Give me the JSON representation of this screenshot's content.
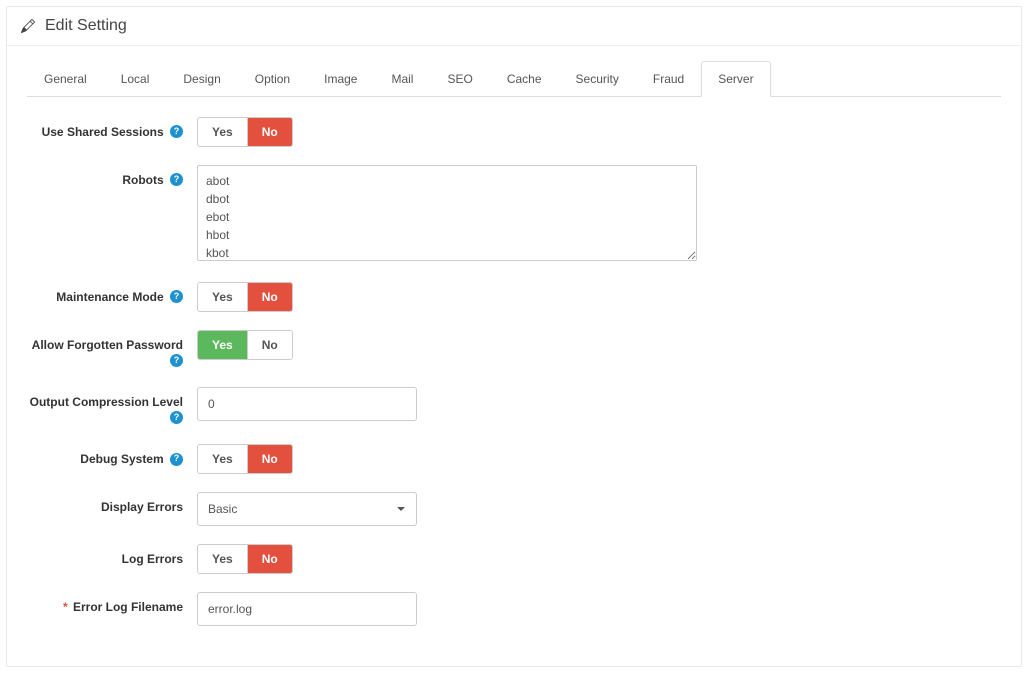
{
  "header": {
    "title": "Edit Setting"
  },
  "tabs": [
    {
      "label": "General",
      "active": false
    },
    {
      "label": "Local",
      "active": false
    },
    {
      "label": "Design",
      "active": false
    },
    {
      "label": "Option",
      "active": false
    },
    {
      "label": "Image",
      "active": false
    },
    {
      "label": "Mail",
      "active": false
    },
    {
      "label": "SEO",
      "active": false
    },
    {
      "label": "Cache",
      "active": false
    },
    {
      "label": "Security",
      "active": false
    },
    {
      "label": "Fraud",
      "active": false
    },
    {
      "label": "Server",
      "active": true
    }
  ],
  "common": {
    "yes": "Yes",
    "no": "No",
    "help_glyph": "?"
  },
  "fields": {
    "shared_sessions": {
      "label": "Use Shared Sessions",
      "value": "No",
      "help": true
    },
    "robots": {
      "label": "Robots",
      "value": "abot\ndbot\nebot\nhbot\nkbot\nlbot",
      "help": true
    },
    "maintenance": {
      "label": "Maintenance Mode",
      "value": "No",
      "help": true
    },
    "forgotten_pw": {
      "label": "Allow Forgotten Password",
      "value": "Yes",
      "help": true
    },
    "compression": {
      "label": "Output Compression Level",
      "value": "0",
      "help": true
    },
    "debug": {
      "label": "Debug System",
      "value": "No",
      "help": true
    },
    "display_errors": {
      "label": "Display Errors",
      "value": "Basic",
      "help": false
    },
    "log_errors": {
      "label": "Log Errors",
      "value": "No",
      "help": false
    },
    "error_log": {
      "label": "Error Log Filename",
      "value": "error.log",
      "required": true,
      "help": false
    }
  }
}
